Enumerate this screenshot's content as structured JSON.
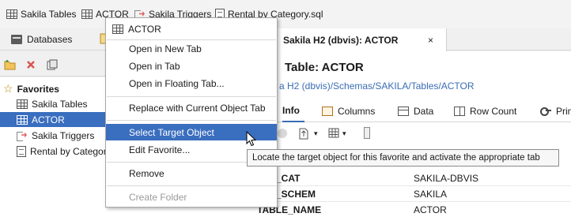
{
  "favorites_bar": {
    "items": [
      {
        "label": "Sakila Tables",
        "icon": "table-icon"
      },
      {
        "label": "ACTOR",
        "icon": "table-icon"
      },
      {
        "label": "Sakila Triggers",
        "icon": "trigger-icon"
      },
      {
        "label": "Rental by Category.sql",
        "icon": "sql-file-icon"
      }
    ]
  },
  "navigator": {
    "tab_label": "Databases",
    "tree": {
      "root_label": "Favorites",
      "items": [
        {
          "label": "Sakila Tables",
          "icon": "table-icon"
        },
        {
          "label": "ACTOR",
          "icon": "table-icon",
          "selected": true
        },
        {
          "label": "Sakila Triggers",
          "icon": "trigger-icon"
        },
        {
          "label": "Rental by Category",
          "icon": "sql-file-icon"
        }
      ]
    }
  },
  "editor": {
    "tab_label": "Sakila H2 (dbvis): ACTOR",
    "tab_close": "×",
    "title": "Table: ACTOR",
    "path": "a H2 (dbvis)/Schemas/SAKILA/Tables/ACTOR",
    "subtabs": [
      "Info",
      "Columns",
      "Data",
      "Row Count",
      "Prim"
    ],
    "properties": [
      {
        "name": "BLE_CAT",
        "value": "SAKILA-DBVIS"
      },
      {
        "name": "BLE_SCHEM",
        "value": "SAKILA"
      },
      {
        "name": "TABLE_NAME",
        "value": "ACTOR"
      }
    ]
  },
  "context_menu": {
    "header": "ACTOR",
    "items": {
      "open_new_tab": "Open in New Tab",
      "open_tab": "Open in Tab",
      "open_floating": "Open in Floating Tab...",
      "replace": "Replace with Current Object Tab",
      "select_target": "Select Target Object",
      "edit_favorite": "Edit Favorite...",
      "remove": "Remove",
      "create_folder": "Create Folder"
    }
  },
  "tooltip": "Locate the target object for this favorite and activate the appropriate tab",
  "colors": {
    "selection": "#3a6ebf",
    "link": "#3a6db5",
    "remove_icon": "#d9534f"
  }
}
